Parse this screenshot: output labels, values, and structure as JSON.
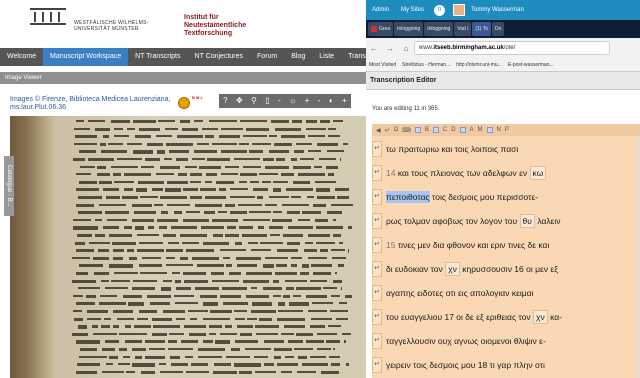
{
  "left_page": {
    "university_name": "WESTFÄLISCHE WILHELMS-UNIVERSITÄT MÜNSTER",
    "institute_name": "Institut für Neutestamentliche Textforschung",
    "nav": [
      "Welcome",
      "Manuscript Workspace",
      "NT Transcripts",
      "NT Conjectures",
      "Forum",
      "Blog",
      "Liste",
      "Transcrip"
    ],
    "image_viewer_title": "Image Viewer",
    "credits": "Images © Firenze, Biblioteca Medicea Laurenziana, ms.laur.Plut.06.36",
    "library_logo_text": "B M L",
    "catalogue_tab": "Catalogue - B...",
    "viewer_tools": [
      "?",
      "✥",
      "⚲",
      "▯",
      "-",
      "☼",
      "+",
      "-",
      "◐",
      "+"
    ]
  },
  "browser": {
    "wp_toolbar": {
      "admin": "Admin",
      "my_sites": "My Sites",
      "count": "0",
      "user": "Tommy Wasserman"
    },
    "tabs": [
      {
        "label": "Grea",
        "style": "red"
      },
      {
        "label": "Inloggning",
        "style": "blue"
      },
      {
        "label": "Inloggning",
        "style": "blue"
      },
      {
        "label": "Vad i",
        "style": "blue"
      },
      {
        "label": "(1) To",
        "style": "fb"
      },
      {
        "label": "Do",
        "style": "blue"
      }
    ],
    "url_prefix": "www.",
    "url_host": "itseeb.birmingham.ac.uk",
    "url_path": "/ote/",
    "bookmarks": [
      "Most Visited",
      "Strelitzius - Herman...",
      "http://ntvmr.uni-mu...",
      "E-post-wasserman..."
    ]
  },
  "editor": {
    "title": "Transcription Editor",
    "editing_info": "You are editing 11 in 365.",
    "toolbar_icons": [
      "◀",
      "↵",
      "Ω",
      "⌨",
      "▢",
      "B",
      "C",
      "D",
      "A",
      "M",
      "N",
      "P"
    ],
    "lines": [
      {
        "pre": "",
        "text": "τω πραιτωριω και τοις λοιποις πασι",
        "nomsac": "",
        "post": ""
      },
      {
        "pre": "14",
        "text": "και τους πλειονας των αδελφων εν",
        "nomsac": "κω",
        "post": ""
      },
      {
        "pre": "",
        "text": "τοις δεσμοις μου περισσοτε-",
        "highlight": "πεποιθοτας",
        "nomsac": "",
        "post": ""
      },
      {
        "pre": "",
        "text": "ρως τολμαν αφοβως τον λογον του",
        "nomsac": "θυ",
        "post": "λαλειν"
      },
      {
        "pre": "15",
        "text": "τινες μεν δια φθονον και εριν τινες δε και",
        "nomsac": "",
        "post": ""
      },
      {
        "pre": "",
        "text": "δι ευδοκιαν τον",
        "nomsac": "χν",
        "post": "κηρυσσουσιν 16 οι μεν εξ"
      },
      {
        "pre": "",
        "text": "αγαπης ειδοτες οτι εις απολογιαν κειμαι",
        "nomsac": "",
        "post": ""
      },
      {
        "pre": "",
        "text": "του ευαγγελιου 17 οι δε εξ εριθειας τον",
        "nomsac": "χν",
        "post": "κα-"
      },
      {
        "pre": "",
        "text": "ταγγελλουσιν ουχ αγνως οιομενοι θλιψιν ε-",
        "nomsac": "",
        "post": ""
      },
      {
        "pre": "",
        "text": "γειρειν τοις δεσμοις μου 18 τι γαρ πλην οτι",
        "nomsac": "",
        "post": ""
      }
    ]
  }
}
